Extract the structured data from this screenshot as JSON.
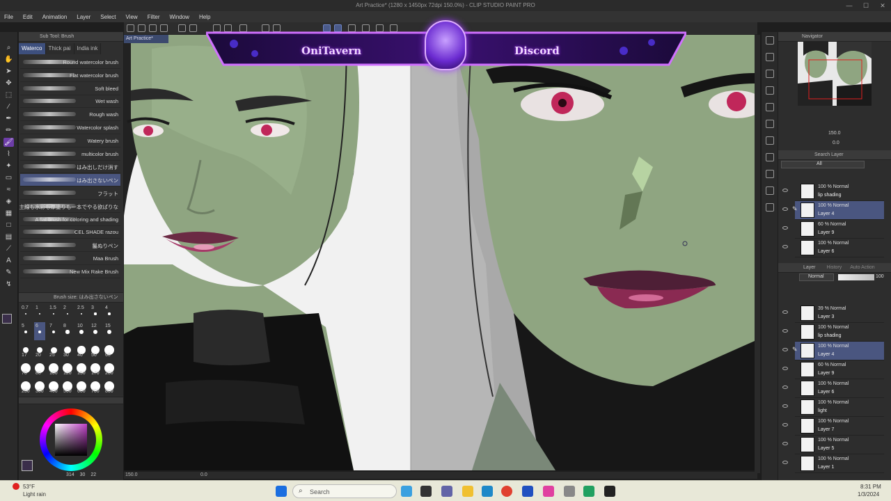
{
  "window": {
    "title": "Art Practice* (1280 x 1450px 72dpi 150.0%) - CLIP STUDIO PAINT PRO"
  },
  "menu": [
    "File",
    "Edit",
    "Animation",
    "Layer",
    "Select",
    "View",
    "Filter",
    "Window",
    "Help"
  ],
  "subtool": {
    "header": "Sub Tool: Brush",
    "tabs": [
      "Waterco",
      "Thick pai",
      "India ink"
    ],
    "brushes": [
      "Round watercolor brush",
      "Flat watercolor brush",
      "Soft bleed",
      "Wet wash",
      "Rough wash",
      "Watercolor splash",
      "Watery brush",
      "multicolor brush",
      "はみ出しだけ消す",
      "はみ出さないペン",
      "フラット",
      "主線も水彩も厚塗りも一本でやる欲ばりな",
      "A flat brush for coloring and shading",
      "CEL SHADE razou",
      "鬣ぬりペン",
      "Maa Brush",
      "New Mix Rake Brush"
    ],
    "selected_index": 9
  },
  "brush_size": {
    "header": "Brush size: はみ出さないペン",
    "sizes": [
      "0.7",
      "1",
      "1.5",
      "2",
      "2.5",
      "3",
      "4",
      "5",
      "6",
      "7",
      "8",
      "10",
      "12",
      "15",
      "17",
      "20",
      "25",
      "30",
      "40",
      "50",
      "60",
      "70",
      "80",
      "100",
      "120",
      "150",
      "170",
      "200",
      "250",
      "300",
      "400",
      "500",
      "600",
      "700",
      "800"
    ],
    "selected": "6"
  },
  "color": {
    "main": "#3a2e4a",
    "sub": "#1a1a1a",
    "readout": [
      "314",
      "30",
      "22"
    ]
  },
  "canvas": {
    "doc_tab": "Art Practice*",
    "zoom": "150.0",
    "position": "0.0"
  },
  "banner": {
    "left_text": "OniTavern",
    "right_text": "Discord"
  },
  "navigator": {
    "title": "Navigator",
    "zoom": "150.0",
    "angle": "0.0"
  },
  "search_layer": {
    "title": "Search Layer",
    "filter": "All"
  },
  "layer_search_results": [
    {
      "mode": "100 % Normal",
      "name": "lip shading"
    },
    {
      "mode": "100 % Normal",
      "name": "Layer 4",
      "selected": true
    },
    {
      "mode": "60 % Normal",
      "name": "Layer 9"
    },
    {
      "mode": "100 % Normal",
      "name": "Layer 6"
    }
  ],
  "layer_panel": {
    "tabs": [
      "Layer",
      "History",
      "Auto Action"
    ],
    "blend": "Normal",
    "opacity": "100"
  },
  "layers": [
    {
      "mode": "39 % Normal",
      "name": "Layer 3"
    },
    {
      "mode": "100 % Normal",
      "name": "lip shading"
    },
    {
      "mode": "100 % Normal",
      "name": "Layer 4",
      "selected": true
    },
    {
      "mode": "60 % Normal",
      "name": "Layer 9"
    },
    {
      "mode": "100 % Normal",
      "name": "Layer 6"
    },
    {
      "mode": "100 % Normal",
      "name": "light"
    },
    {
      "mode": "100 % Normal",
      "name": "Layer 7"
    },
    {
      "mode": "100 % Normal",
      "name": "Layer 5"
    },
    {
      "mode": "100 % Normal",
      "name": "Layer 1"
    }
  ],
  "taskbar": {
    "weather_temp": "53°F",
    "weather_desc": "Light rain",
    "search_placeholder": "Search",
    "time": "8:31 PM",
    "date": "1/3/2024"
  }
}
